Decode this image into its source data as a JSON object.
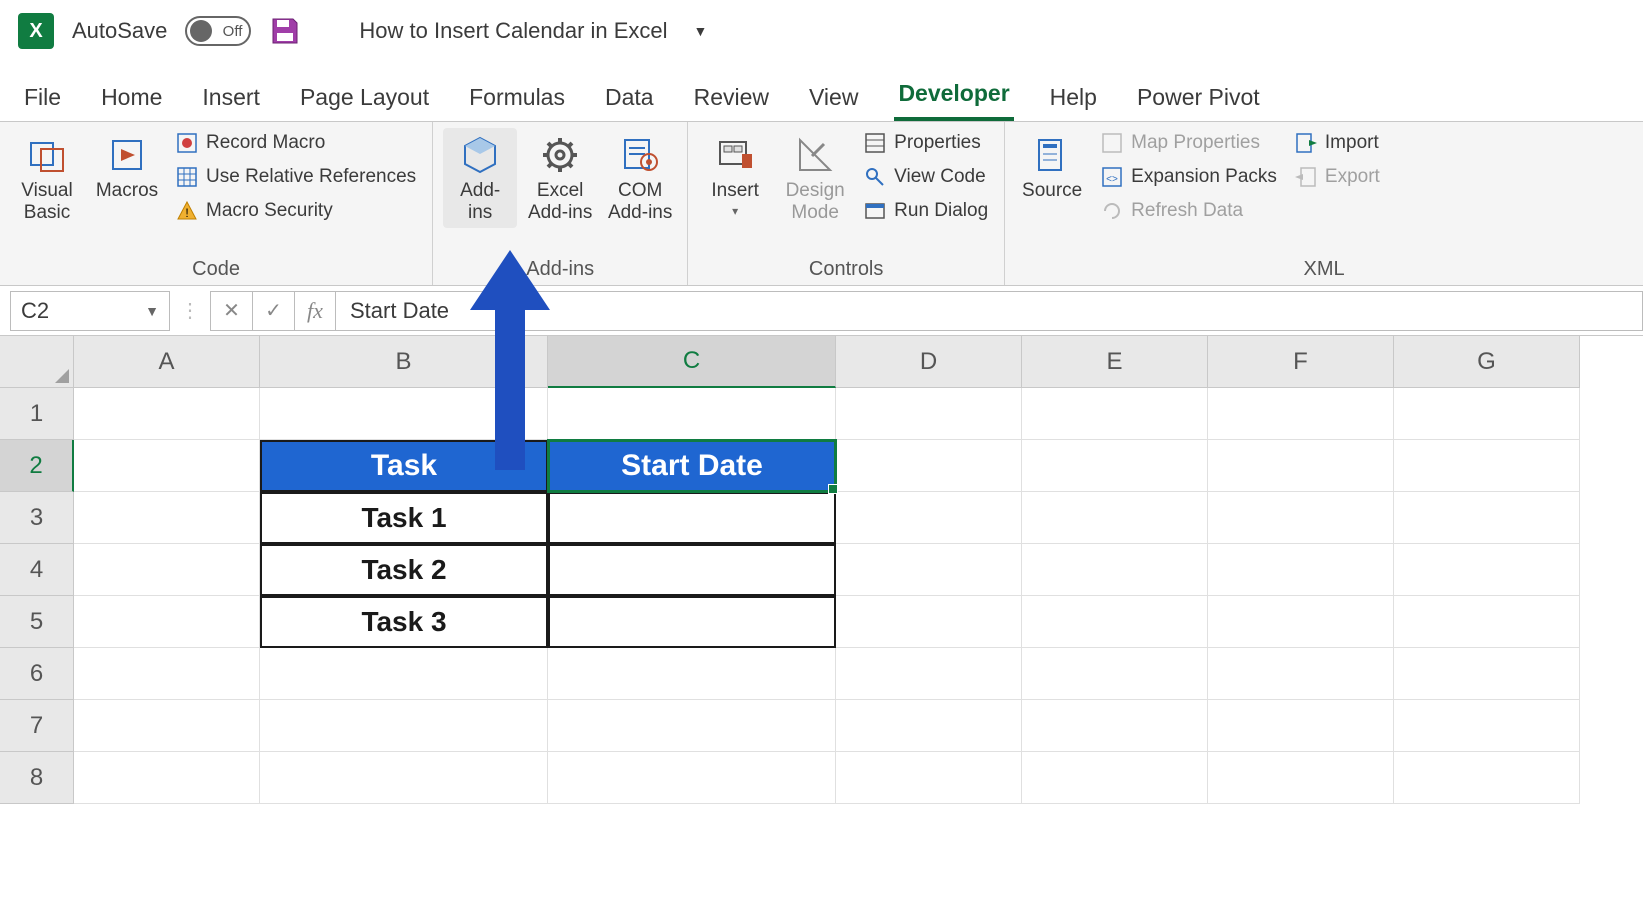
{
  "title_bar": {
    "app_letter": "X",
    "autosave_label": "AutoSave",
    "autosave_state": "Off",
    "document_title": "How to Insert Calendar in Excel"
  },
  "tabs": {
    "file": "File",
    "home": "Home",
    "insert": "Insert",
    "page_layout": "Page Layout",
    "formulas": "Formulas",
    "data": "Data",
    "review": "Review",
    "view": "View",
    "developer": "Developer",
    "help": "Help",
    "power_pivot": "Power Pivot"
  },
  "ribbon": {
    "code": {
      "visual_basic": "Visual\nBasic",
      "macros": "Macros",
      "record_macro": "Record Macro",
      "use_relative": "Use Relative References",
      "macro_security": "Macro Security",
      "group_label": "Code"
    },
    "addins": {
      "addins": "Add-\nins",
      "excel_addins": "Excel\nAdd-ins",
      "com_addins": "COM\nAdd-ins",
      "group_label": "Add-ins"
    },
    "controls": {
      "insert": "Insert",
      "design_mode": "Design\nMode",
      "properties": "Properties",
      "view_code": "View Code",
      "run_dialog": "Run Dialog",
      "group_label": "Controls"
    },
    "xml": {
      "source": "Source",
      "map_properties": "Map Properties",
      "expansion_packs": "Expansion Packs",
      "refresh_data": "Refresh Data",
      "import": "Import",
      "export": "Export",
      "group_label": "XML"
    }
  },
  "formula_bar": {
    "name_box": "C2",
    "fx_label": "fx",
    "formula_value": "Start Date"
  },
  "columns": {
    "a": "A",
    "b": "B",
    "c": "C",
    "d": "D",
    "e": "E",
    "f": "F",
    "g": "G"
  },
  "rows": {
    "r1": "1",
    "r2": "2",
    "r3": "3",
    "r4": "4",
    "r5": "5",
    "r6": "6",
    "r7": "7",
    "r8": "8"
  },
  "table": {
    "header_task": "Task",
    "header_start": "Start Date",
    "task1": "Task 1",
    "task2": "Task 2",
    "task3": "Task 3"
  }
}
